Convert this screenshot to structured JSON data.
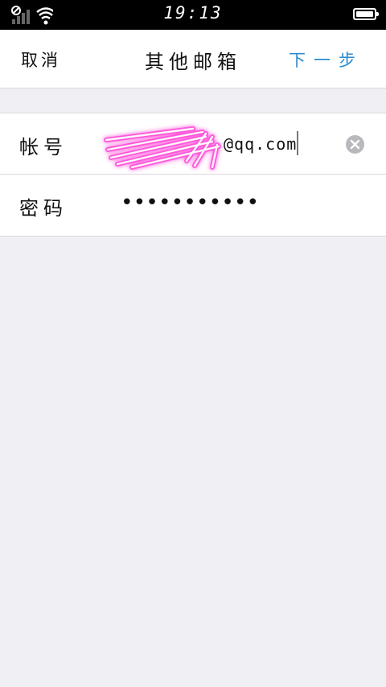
{
  "status_bar": {
    "time": "19:13",
    "icons": [
      "no-sim-icon",
      "signal-bars-icon",
      "wifi-icon",
      "battery-icon"
    ],
    "battery_level": 1.0
  },
  "nav": {
    "cancel_label": "取消",
    "title": "其他邮箱",
    "next_label": "下一步",
    "next_color": "#2d8ad0"
  },
  "form": {
    "account": {
      "label": "帐号",
      "value_visible": "@qq.com",
      "note_redacted": true,
      "clear_icon": "clear-circle-icon"
    },
    "password": {
      "label": "密码",
      "value": "•••••••••••"
    }
  },
  "colors": {
    "background": "#efeff4",
    "redaction": "#ff4fd8"
  }
}
